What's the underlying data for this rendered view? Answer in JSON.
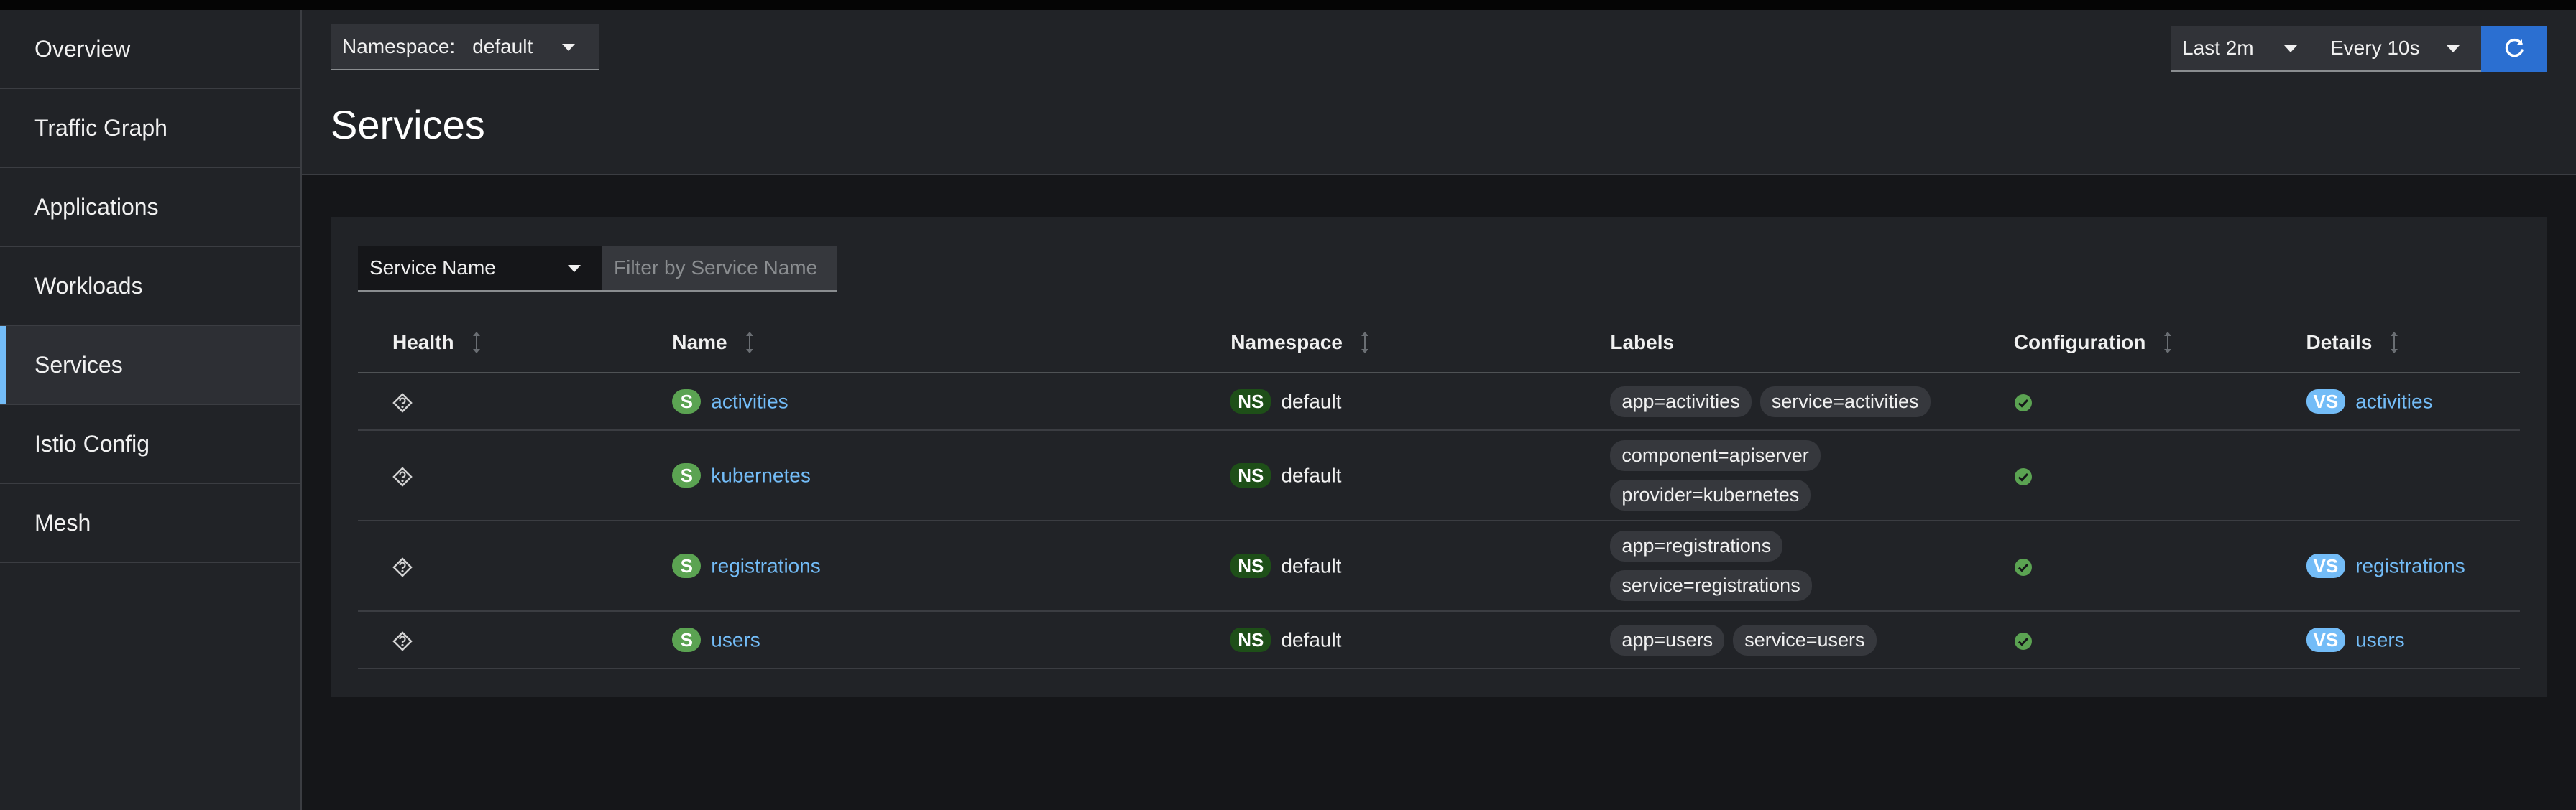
{
  "sidebar": {
    "items": [
      {
        "label": "Overview"
      },
      {
        "label": "Traffic Graph"
      },
      {
        "label": "Applications"
      },
      {
        "label": "Workloads"
      },
      {
        "label": "Services"
      },
      {
        "label": "Istio Config"
      },
      {
        "label": "Mesh"
      }
    ],
    "active": "Services"
  },
  "header": {
    "namespace_label": "Namespace:",
    "namespace_value": "default",
    "title": "Services",
    "time_range": "Last 2m",
    "refresh_interval": "Every 10s",
    "refresh_icon": "refresh-icon"
  },
  "filter": {
    "type": "Service Name",
    "placeholder": "Filter by Service Name",
    "value": ""
  },
  "table": {
    "columns": [
      "Health",
      "Name",
      "Namespace",
      "Labels",
      "Configuration",
      "Details"
    ],
    "rows": [
      {
        "health_icon": "unknown-health-icon",
        "badge": "S",
        "name": "activities",
        "ns_badge": "NS",
        "namespace": "default",
        "labels": [
          "app=activities",
          "service=activities"
        ],
        "config": "valid",
        "details_badge": "VS",
        "details": "activities"
      },
      {
        "health_icon": "unknown-health-icon",
        "badge": "S",
        "name": "kubernetes",
        "ns_badge": "NS",
        "namespace": "default",
        "labels": [
          "component=apiserver",
          "provider=kubernetes"
        ],
        "config": "valid",
        "details_badge": "",
        "details": ""
      },
      {
        "health_icon": "unknown-health-icon",
        "badge": "S",
        "name": "registrations",
        "ns_badge": "NS",
        "namespace": "default",
        "labels": [
          "app=registrations",
          "service=registrations"
        ],
        "config": "valid",
        "details_badge": "VS",
        "details": "registrations"
      },
      {
        "health_icon": "unknown-health-icon",
        "badge": "S",
        "name": "users",
        "ns_badge": "NS",
        "namespace": "default",
        "labels": [
          "app=users",
          "service=users"
        ],
        "config": "valid",
        "details_badge": "VS",
        "details": "users"
      }
    ]
  },
  "colors": {
    "accent": "#73bcf7",
    "primary_button": "#2b6fd1",
    "service_badge": "#5ba352",
    "namespace_badge": "#1e4f18",
    "valid": "#5ba352"
  }
}
